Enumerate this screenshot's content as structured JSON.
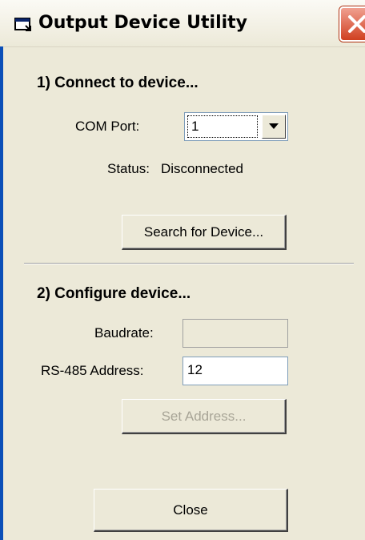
{
  "window": {
    "title": "Output Device Utility",
    "icon": "app-window-icon",
    "close_icon": "close-icon"
  },
  "section1": {
    "heading": "1) Connect to device...",
    "com_port_label": "COM Port:",
    "com_port_value": "1",
    "status_label": "Status:",
    "status_value": "Disconnected",
    "search_button": "Search for Device..."
  },
  "section2": {
    "heading": "2) Configure device...",
    "baudrate_label": "Baudrate:",
    "baudrate_value": "",
    "address_label": "RS-485 Address:",
    "address_value": "12",
    "set_address_button": "Set Address..."
  },
  "footer": {
    "close_button": "Close"
  },
  "colors": {
    "dialog_bg": "#ece9d8",
    "close_button_red": "#d04020",
    "disabled_text": "#a8a597"
  }
}
